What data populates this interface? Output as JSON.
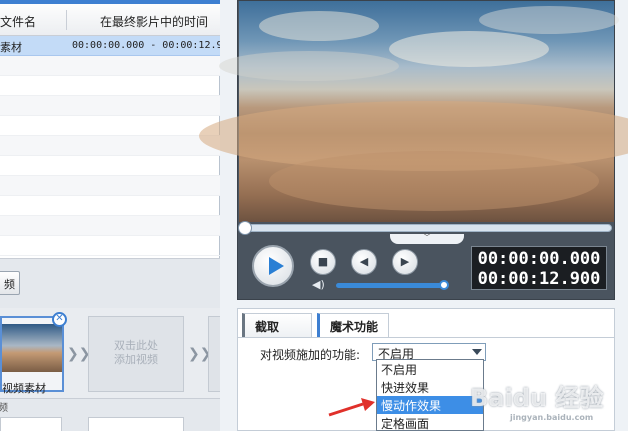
{
  "file_list": {
    "columns": [
      "文件名",
      "在最终影片中的时间"
    ],
    "rows": [
      {
        "name": "素材",
        "time": "00:00:00.000 - 00:00:12.9"
      }
    ]
  },
  "toolbar": {
    "button_label": "频"
  },
  "storyboard": {
    "clip_label": "视频素材",
    "add_slot_text": "双击此处\n添加视频",
    "add_slot_line1": "双击此处",
    "add_slot_line2": "添加视频",
    "bottom_label": "频"
  },
  "player": {
    "time_current": "00:00:00.000",
    "time_total": "00:00:12.900",
    "volume": 1.0,
    "icons": {
      "play": "play-icon",
      "stop": "stop-icon",
      "prev": "step-back-icon",
      "next": "step-forward-icon",
      "volume": "speaker-icon"
    },
    "accent": "#2a7fd4"
  },
  "tabs": [
    {
      "label": "截取",
      "active": false
    },
    {
      "label": "魔术功能",
      "active": true
    }
  ],
  "magic": {
    "field_label": "对视频施加的功能:",
    "selected": "不启用",
    "options": [
      "不启用",
      "快进效果",
      "慢动作效果",
      "定格画面"
    ],
    "highlighted": "慢动作效果"
  },
  "watermark": {
    "main": "Baidu 经验",
    "sub": "jingyan.baidu.com"
  }
}
